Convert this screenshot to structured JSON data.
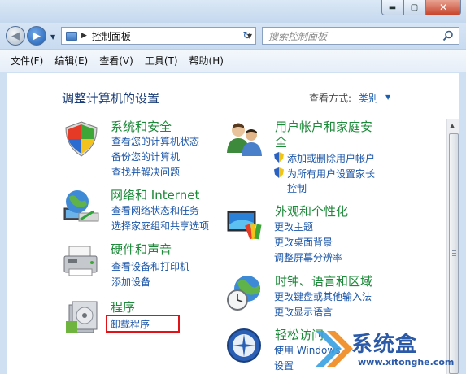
{
  "window": {
    "minimize_glyph": "▬",
    "maximize_glyph": "▢",
    "close_glyph": "✕"
  },
  "address": {
    "path": "控制面板",
    "search_placeholder": "搜索控制面板"
  },
  "menu": [
    "文件(F)",
    "编辑(E)",
    "查看(V)",
    "工具(T)",
    "帮助(H)"
  ],
  "content": {
    "heading": "调整计算机的设置",
    "view_by_label": "查看方式:",
    "view_by_value": "类别"
  },
  "categories": {
    "system": {
      "title": "系统和安全",
      "links": [
        "查看您的计算机状态",
        "备份您的计算机",
        "查找并解决问题"
      ]
    },
    "network": {
      "title": "网络和 Internet",
      "links": [
        "查看网络状态和任务",
        "选择家庭组和共享选项"
      ]
    },
    "hardware": {
      "title": "硬件和声音",
      "links": [
        "查看设备和打印机",
        "添加设备"
      ]
    },
    "programs": {
      "title": "程序",
      "links": [
        "卸载程序"
      ]
    },
    "users": {
      "title_line1": "用户帐户和家庭安",
      "title_line2": "全",
      "links": [
        "添加或删除用户帐户",
        "为所有用户设置家长",
        "控制"
      ]
    },
    "appearance": {
      "title": "外观和个性化",
      "links": [
        "更改主题",
        "更改桌面背景",
        "调整屏幕分辨率"
      ]
    },
    "clock": {
      "title": "时钟、语言和区域",
      "links": [
        "更改键盘或其他输入法",
        "更改显示语言"
      ]
    },
    "ease": {
      "title": "轻松访问",
      "links": [
        "使用 Windows",
        "设置"
      ]
    }
  },
  "watermark": {
    "brand": "系统盒",
    "url": "www.xitonghe.com"
  },
  "colors": {
    "category_title": "#1d8a3a",
    "link": "#1b56a8",
    "heading": "#1b3e78",
    "highlight_box": "#e11218"
  }
}
